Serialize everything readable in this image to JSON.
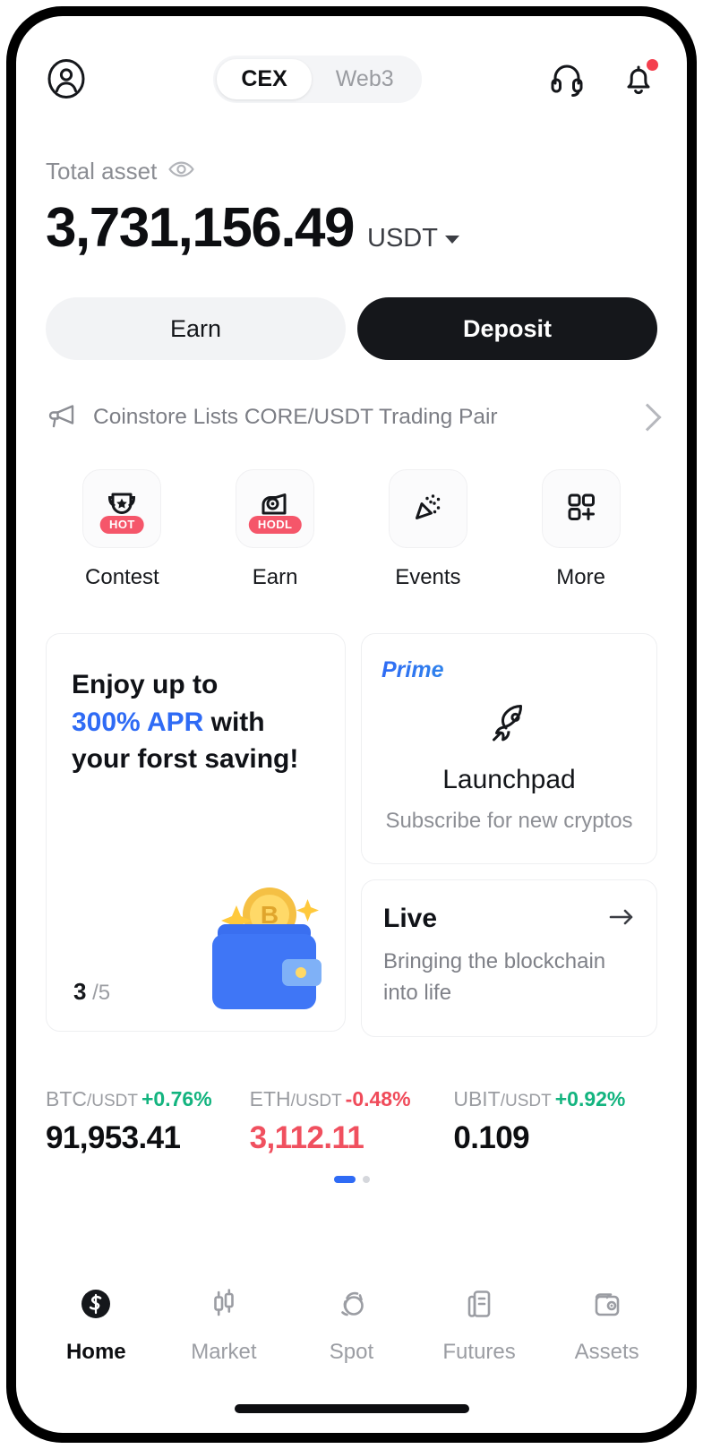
{
  "app": {
    "name": "Coinstore",
    "accent_blue": "#2f6bf5",
    "accent_green": "#13b47f",
    "accent_red": "#f0505f",
    "badge_red": "#f5566a"
  },
  "topbar": {
    "profile_icon": "user-circle-icon",
    "tabs": [
      {
        "label": "CEX",
        "active": true
      },
      {
        "label": "Web3",
        "active": false
      }
    ],
    "support_icon": "headset-icon",
    "notification_icon": "bell-icon",
    "notification_has_badge": true
  },
  "asset": {
    "label": "Total asset",
    "eye_icon": "eye-icon",
    "amount": "3,731,156.49",
    "currency": "USDT",
    "currency_caret_icon": "chevron-down-icon"
  },
  "actions": {
    "earn_label": "Earn",
    "deposit_label": "Deposit"
  },
  "announcement": {
    "megaphone_icon": "megaphone-icon",
    "text": "Coinstore Lists CORE/USDT Trading Pair",
    "chevron_icon": "chevron-right-icon"
  },
  "quick_actions": [
    {
      "label": "Contest",
      "icon": "trophy-icon",
      "badge": "HOT"
    },
    {
      "label": "Earn",
      "icon": "piggy-hodl-icon",
      "badge": "HODL"
    },
    {
      "label": "Events",
      "icon": "party-popper-icon",
      "badge": ""
    },
    {
      "label": "More",
      "icon": "grid-plus-icon",
      "badge": ""
    }
  ],
  "promo": {
    "headline_line1": "Enjoy up to",
    "headline_accent": "300% APR",
    "headline_line2_tail": " with",
    "headline_line3": "your forst saving!",
    "counter_current": "3",
    "counter_total": "/5",
    "illustration": "wallet-bitcoin-icon"
  },
  "prime_card": {
    "tag": "Prime",
    "icon": "rocket-icon",
    "title": "Launchpad",
    "subtitle": "Subscribe for new cryptos"
  },
  "live_card": {
    "title": "Live",
    "arrow_icon": "arrow-right-icon",
    "subtitle": "Bringing the blockchain into life"
  },
  "tickers": [
    {
      "base": "BTC",
      "quote": "/USDT",
      "change": "+0.76%",
      "direction": "up",
      "price": "91,953.41",
      "price_direction": "neutral"
    },
    {
      "base": "ETH",
      "quote": "/USDT",
      "change": "-0.48%",
      "direction": "down",
      "price": "3,112.11",
      "price_direction": "down"
    },
    {
      "base": "UBIT",
      "quote": "/USDT",
      "change": "+0.92%",
      "direction": "up",
      "price": "0.109",
      "price_direction": "neutral"
    }
  ],
  "carousel": {
    "total": 2,
    "active_index": 0
  },
  "bottom_nav": [
    {
      "label": "Home",
      "icon": "coinstore-logo-icon",
      "active": true
    },
    {
      "label": "Market",
      "icon": "candlestick-icon",
      "active": false
    },
    {
      "label": "Spot",
      "icon": "spot-swap-icon",
      "active": false
    },
    {
      "label": "Futures",
      "icon": "futures-doc-icon",
      "active": false
    },
    {
      "label": "Assets",
      "icon": "wallet-icon",
      "active": false
    }
  ]
}
